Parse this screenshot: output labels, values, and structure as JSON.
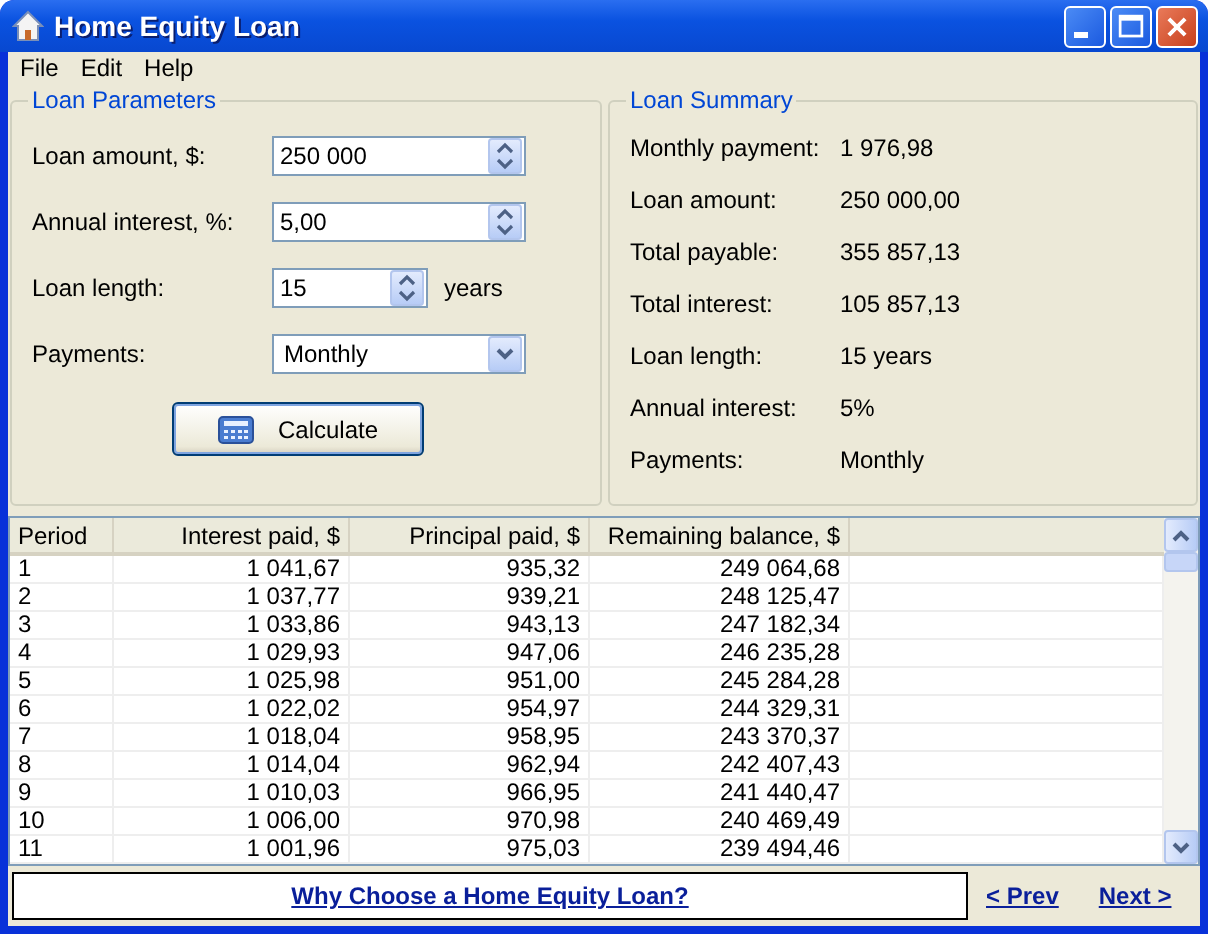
{
  "window": {
    "title": "Home Equity Loan"
  },
  "menu": [
    "File",
    "Edit",
    "Help"
  ],
  "loan_parameters": {
    "title": "Loan Parameters",
    "fields": [
      {
        "label": "Loan amount, $:",
        "value": "250 000",
        "kind": "spin"
      },
      {
        "label": "Annual interest, %:",
        "value": "5,00",
        "kind": "spin"
      },
      {
        "label": "Loan length:",
        "value": "15",
        "kind": "spin-short",
        "unit": "years"
      },
      {
        "label": "Payments:",
        "value": "Monthly",
        "kind": "dropdown"
      }
    ],
    "button": "Calculate"
  },
  "loan_summary": {
    "title": "Loan Summary",
    "rows": [
      {
        "label": "Monthly payment:",
        "value": "1 976,98"
      },
      {
        "label": "Loan amount:",
        "value": "250 000,00"
      },
      {
        "label": "Total payable:",
        "value": "355 857,13"
      },
      {
        "label": "Total interest:",
        "value": "105 857,13"
      },
      {
        "label": "Loan length:",
        "value": "15 years"
      },
      {
        "label": "Annual interest:",
        "value": "5%"
      },
      {
        "label": "Payments:",
        "value": "Monthly"
      }
    ]
  },
  "table": {
    "columns": [
      "Period",
      "Interest paid, $",
      "Principal paid, $",
      "Remaining balance, $"
    ],
    "rows": [
      [
        "1",
        "1 041,67",
        "935,32",
        "249 064,68"
      ],
      [
        "2",
        "1 037,77",
        "939,21",
        "248 125,47"
      ],
      [
        "3",
        "1 033,86",
        "943,13",
        "247 182,34"
      ],
      [
        "4",
        "1 029,93",
        "947,06",
        "246 235,28"
      ],
      [
        "5",
        "1 025,98",
        "951,00",
        "245 284,28"
      ],
      [
        "6",
        "1 022,02",
        "954,97",
        "244 329,31"
      ],
      [
        "7",
        "1 018,04",
        "958,95",
        "243 370,37"
      ],
      [
        "8",
        "1 014,04",
        "962,94",
        "242 407,43"
      ],
      [
        "9",
        "1 010,03",
        "966,95",
        "241 440,47"
      ],
      [
        "10",
        "1 006,00",
        "970,98",
        "240 469,49"
      ],
      [
        "11",
        "1 001,96",
        "975,03",
        "239 494,46"
      ]
    ]
  },
  "footer": {
    "link": "Why Choose a Home Equity Loan?",
    "prev": "< Prev",
    "next": "Next >"
  }
}
